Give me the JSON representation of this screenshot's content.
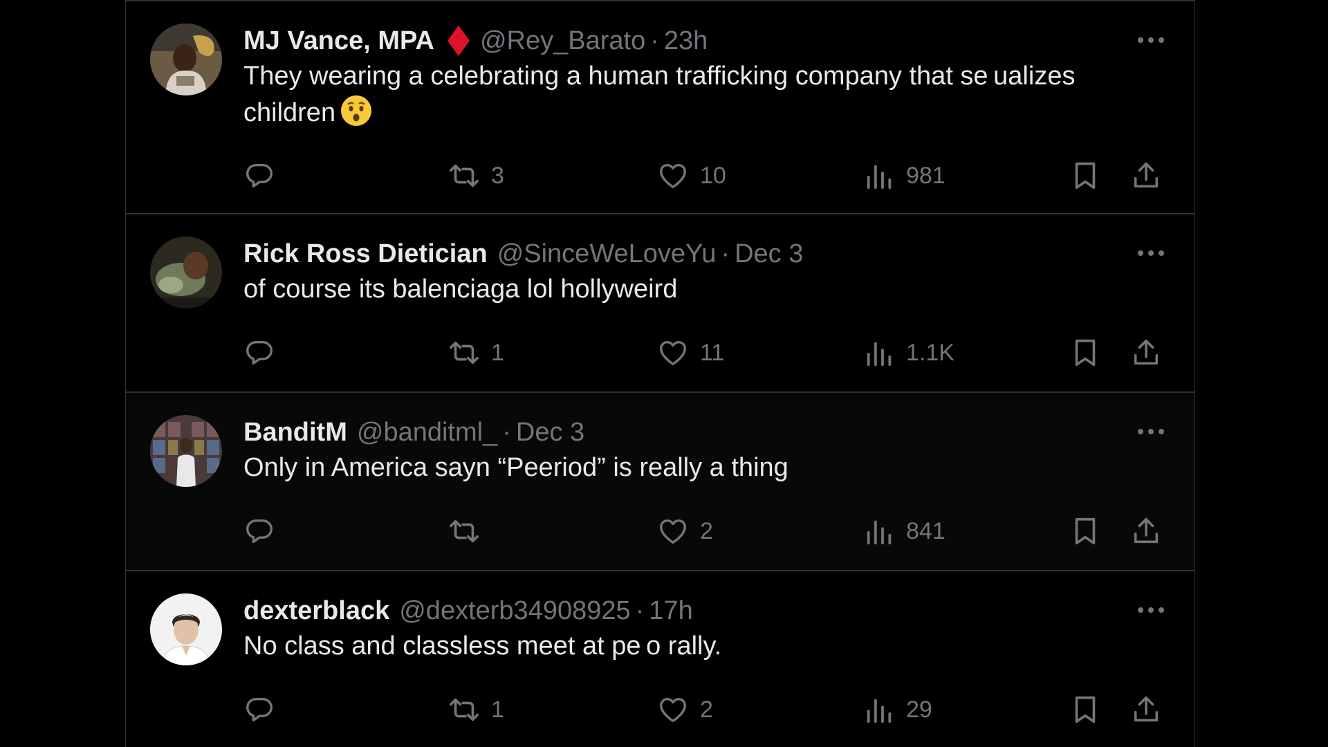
{
  "tweets": [
    {
      "name": "MJ Vance, MPA",
      "badge": "red-diamond-icon",
      "handle": "@Rey_Barato",
      "sep": "·",
      "time": "23h",
      "text": "They wearing a celebrating a human trafficking company that se ualizes children",
      "emoji": "hushed-face-emoji",
      "replies": "",
      "retweets": "3",
      "likes": "10",
      "views": "981"
    },
    {
      "name": "Rick Ross Dietician",
      "handle": "@SinceWeLoveYu",
      "sep": "·",
      "time": "Dec 3",
      "text": "of course its balenciaga lol hollyweird",
      "replies": "",
      "retweets": "1",
      "likes": "11",
      "views": "1.1K"
    },
    {
      "name": "BanditM",
      "handle": "@banditml_",
      "sep": "·",
      "time": "Dec 3",
      "text": "Only in America sayn “Peeriod” is really a thing",
      "replies": "",
      "retweets": "",
      "likes": "2",
      "views": "841"
    },
    {
      "name": "dexterblack",
      "handle": "@dexterb34908925",
      "sep": "·",
      "time": "17h",
      "text": "No class and classless meet at pe o rally.",
      "replies": "",
      "retweets": "1",
      "likes": "2",
      "views": "29"
    }
  ],
  "colors": {
    "background": "#000000",
    "text_primary": "#e7e9ea",
    "text_secondary": "#71767b",
    "divider": "#2f3336",
    "badge": "#e0112b"
  }
}
